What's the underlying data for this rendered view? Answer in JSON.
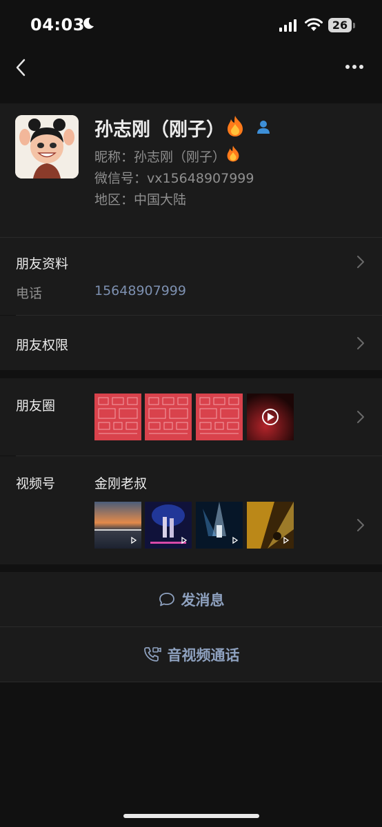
{
  "status_bar": {
    "time": "04:03",
    "battery": "26",
    "icons": [
      "moon-icon",
      "cellular-signal-icon",
      "wifi-icon",
      "battery-icon"
    ]
  },
  "nav": {
    "icons": [
      "back-chevron-icon",
      "more-dots-icon"
    ]
  },
  "profile": {
    "name": "孙志刚（刚子）",
    "nickname_label": "昵称：",
    "nickname_value": "孙志刚（刚子）",
    "wechat_id_label": "微信号：",
    "wechat_id_value": "vx15648907999",
    "region_label": "地区：",
    "region_value": "中国大陆"
  },
  "friend_info": {
    "title": "朋友资料",
    "phone_label": "电话",
    "phone_value": "15648907999"
  },
  "permissions": {
    "title": "朋友权限"
  },
  "moments": {
    "title": "朋友圈"
  },
  "channels": {
    "title": "视频号",
    "channel_name": "金刚老叔"
  },
  "actions": {
    "message": "发消息",
    "call": "音视频通话"
  },
  "colors": {
    "background": "#111111",
    "card": "#1b1b1b",
    "link_blue": "#7d90b0",
    "action_blue": "#8ea1bf",
    "moments_red": "#d9424c"
  }
}
